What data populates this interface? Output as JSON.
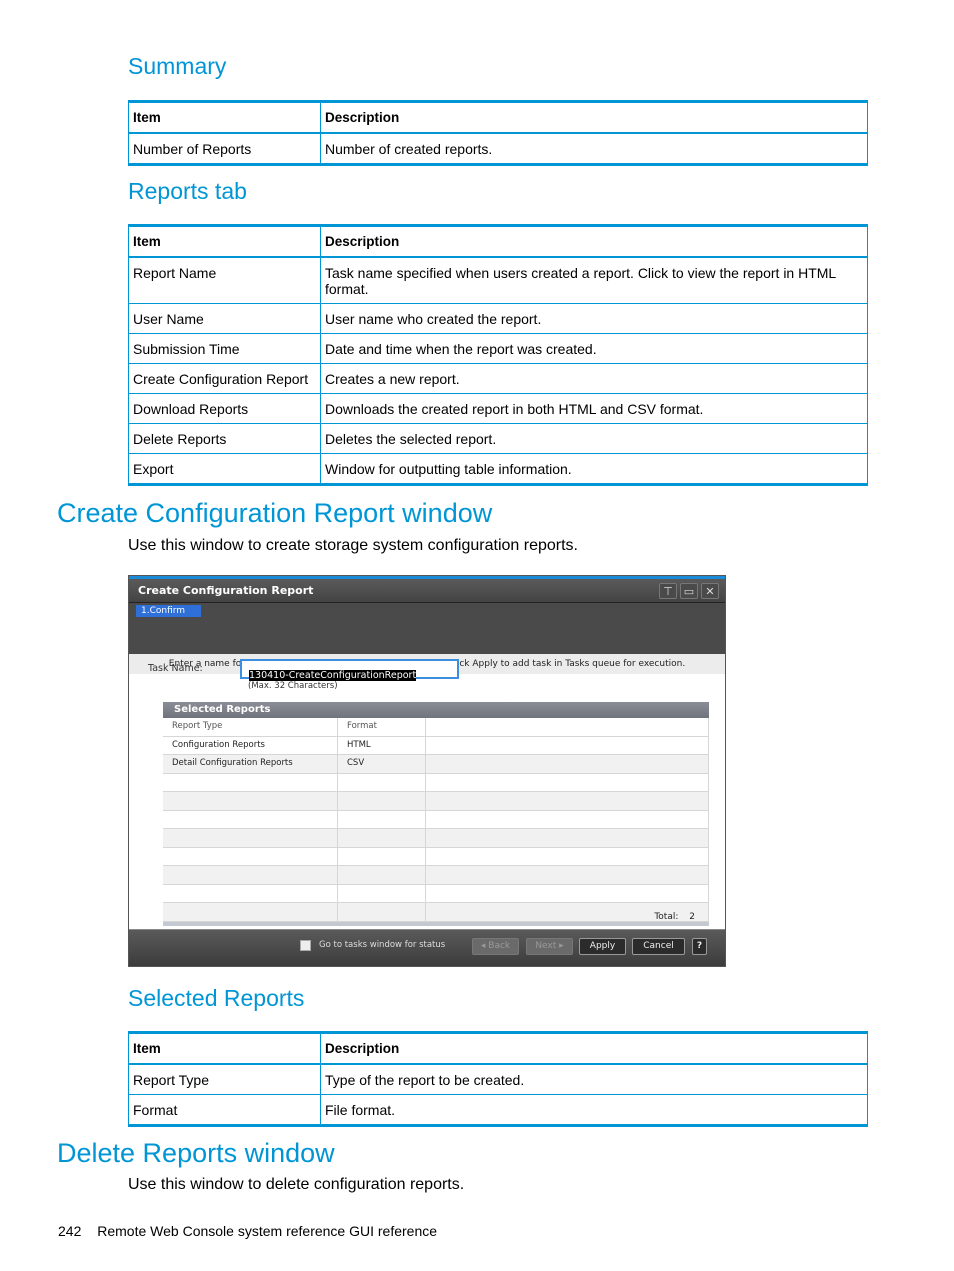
{
  "summary": {
    "heading": "Summary",
    "columns": [
      "Item",
      "Description"
    ],
    "rows": [
      [
        "Number of Reports",
        "Number of created reports."
      ]
    ]
  },
  "reports_tab": {
    "heading": "Reports tab",
    "columns": [
      "Item",
      "Description"
    ],
    "rows": [
      [
        "Report Name",
        "Task name specified when users created a report. Click to view the report in HTML format."
      ],
      [
        "User Name",
        "User name who created the report."
      ],
      [
        "Submission Time",
        "Date and time when the report was created."
      ],
      [
        "Create Configuration Report",
        "Creates a new report."
      ],
      [
        "Download Reports",
        "Downloads the created report in both HTML and CSV format."
      ],
      [
        "Delete Reports",
        "Deletes the selected report."
      ],
      [
        "Export",
        "Window for outputting table information."
      ]
    ]
  },
  "create_section": {
    "heading": "Create Configuration Report window",
    "intro": "Use this window to create storage system configuration reports."
  },
  "dialog": {
    "title": "Create Configuration Report",
    "icons": {
      "pin": "pin-icon",
      "maximize": "maximize-icon",
      "close": "close-icon"
    },
    "step": "1.Confirm",
    "instruction": "Enter a name for the task. Confirm the settings in the list and click Apply to add task in Tasks queue for execution.",
    "task_name_label": "Task Name:",
    "task_name_value": "130410-CreateConfigurationReport",
    "task_name_hint": "(Max. 32 Characters)",
    "selected_reports": {
      "title": "Selected Reports",
      "columns": [
        "Report Type",
        "Format"
      ],
      "rows": [
        [
          "Configuration Reports",
          "HTML"
        ],
        [
          "Detail Configuration Reports",
          "CSV"
        ]
      ],
      "total_label": "Total:",
      "total_value": "2"
    },
    "footer": {
      "checkbox_label": "Go to tasks window for status",
      "checkbox_checked": false,
      "back": "Back",
      "next": "Next",
      "apply": "Apply",
      "cancel": "Cancel",
      "help": "?"
    }
  },
  "selected_reports_table": {
    "heading": "Selected Reports",
    "columns": [
      "Item",
      "Description"
    ],
    "rows": [
      [
        "Report Type",
        "Type of the report to be created."
      ],
      [
        "Format",
        "File format."
      ]
    ]
  },
  "delete_section": {
    "heading": "Delete Reports window",
    "intro": "Use this window to delete configuration reports."
  },
  "footer": {
    "page_number": "242",
    "text": "Remote Web Console system reference GUI reference"
  },
  "colors": {
    "accent": "#0096d6",
    "dialog_step": "#2e6fd8"
  }
}
